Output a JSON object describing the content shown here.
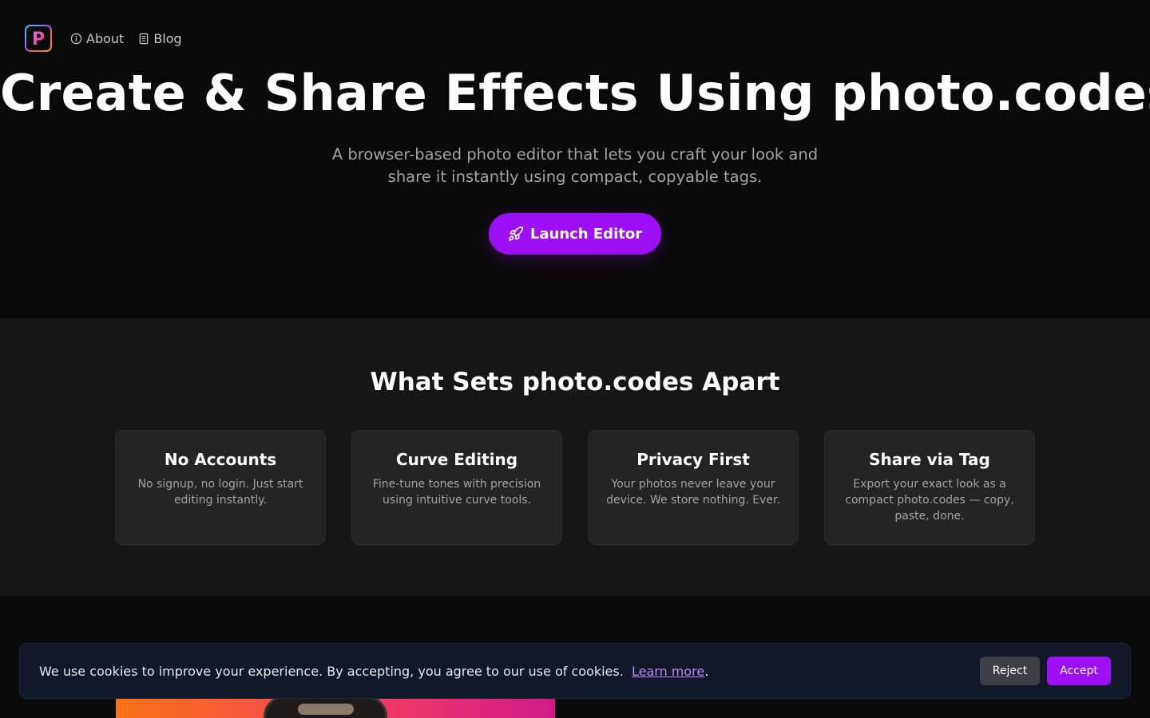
{
  "nav": {
    "logo_letter": "P",
    "links": [
      {
        "label": "About",
        "icon": "info-icon"
      },
      {
        "label": "Blog",
        "icon": "document-icon"
      }
    ]
  },
  "hero": {
    "title": "Create & Share Effects Using photo.codes",
    "subtitle": "A browser-based photo editor that lets you craft your look and share it instantly using compact, copyable tags.",
    "cta_label": "Launch Editor",
    "cta_icon": "rocket-icon"
  },
  "features": {
    "title": "What Sets photo.codes Apart",
    "cards": [
      {
        "title": "No Accounts",
        "text": "No signup, no login. Just start editing instantly."
      },
      {
        "title": "Curve Editing",
        "text": "Fine-tune tones with precision using intuitive curve tools."
      },
      {
        "title": "Privacy First",
        "text": "Your photos never leave your device. We store nothing. Ever."
      },
      {
        "title": "Share via Tag",
        "text": "Export your exact look as a compact photo.codes — copy, paste, done."
      }
    ]
  },
  "cookie_banner": {
    "message": "We use cookies to improve your experience. By accepting, you agree to our use of cookies.",
    "link_label": "Learn more",
    "trailing": ".",
    "reject_label": "Reject",
    "accept_label": "Accept"
  },
  "colors": {
    "accent": "#9d10f5",
    "background": "#0a0a0a",
    "section_background": "#161616",
    "card_background": "#242424"
  }
}
